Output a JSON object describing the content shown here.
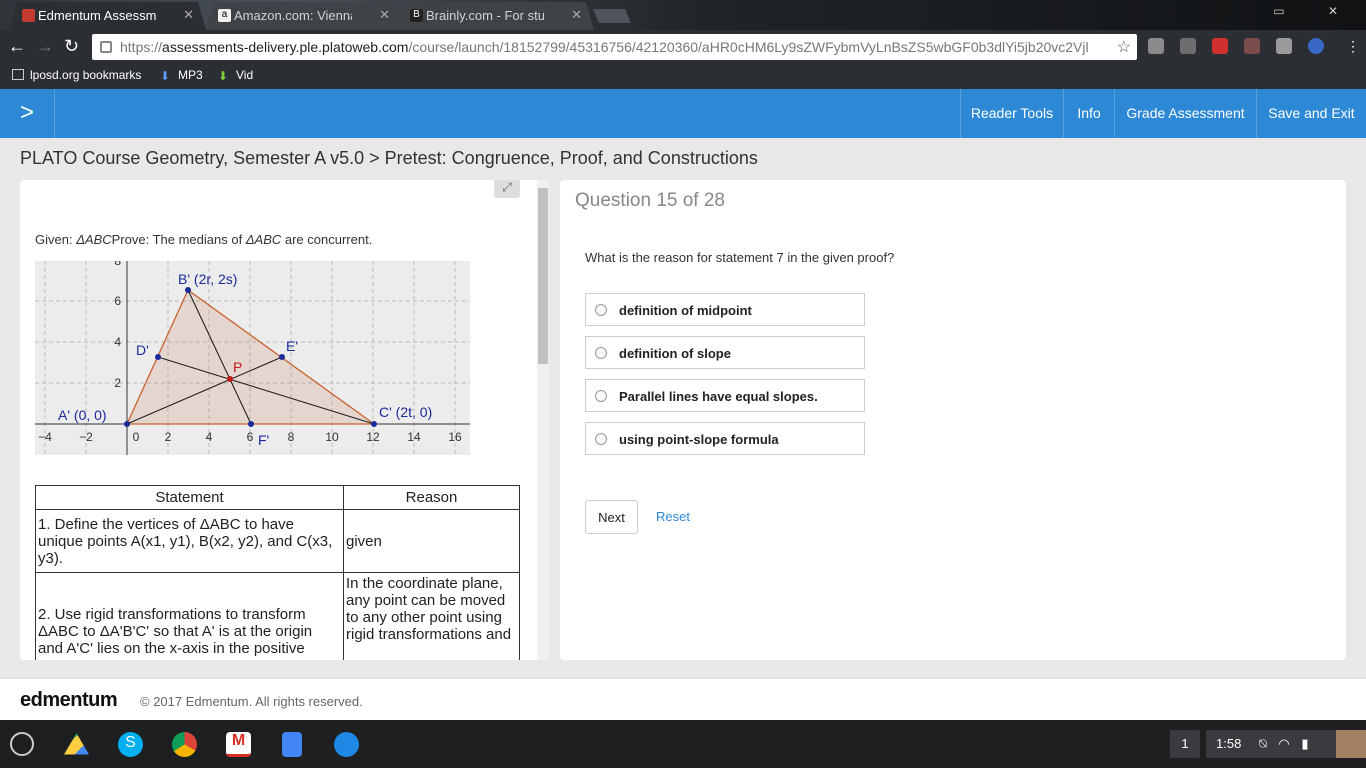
{
  "browser": {
    "tabs": [
      {
        "title": "Edmentum Assessment",
        "active": true,
        "favicon_color": "#c23b2e"
      },
      {
        "title": "Amazon.com: Vienna B",
        "active": false,
        "favicon_color": "#f0f0f0"
      },
      {
        "title": "Brainly.com - For studen",
        "active": false,
        "favicon_color": "#222222"
      }
    ],
    "url_scheme": "https://",
    "url_host": "assessments-delivery.ple.platoweb.com",
    "url_path": "/course/launch/18152799/45316756/42120360/aHR0cHM6Ly9sZWFybmVyLnBsZS5wbGF0b3dlYi5jb20vc2Vjl",
    "bookmarks": [
      {
        "label": "lposd.org bookmarks",
        "icon": "folder-icon"
      },
      {
        "label": "MP3",
        "icon": "download-icon"
      },
      {
        "label": "Vid",
        "icon": "download-green-icon"
      }
    ]
  },
  "appbar": {
    "buttons": [
      "Reader Tools",
      "Info",
      "Grade Assessment",
      "Save and Exit"
    ],
    "accent": "#2d89d6"
  },
  "breadcrumb": "PLATO Course Geometry, Semester A v5.0 > Pretest: Congruence, Proof, and Constructions",
  "left": {
    "given_prefix": "Given: ",
    "given_tri": "ΔABC",
    "prove_prefix": "Prove: The medians of ",
    "prove_tri": "ΔABC",
    "prove_suffix": " are concurrent.",
    "graph": {
      "x_ticks": [
        "−4",
        "−2",
        "0",
        "2",
        "4",
        "6",
        "8",
        "10",
        "12",
        "14",
        "16"
      ],
      "y_ticks": [
        "2",
        "4",
        "6",
        "8"
      ],
      "labels": {
        "A": "A' (0, 0)",
        "B": "B' (2r, 2s)",
        "C": "C' (2t, 0)",
        "D": "D'",
        "E": "E'",
        "F": "F'",
        "P": "P"
      }
    },
    "table": {
      "headers": [
        "Statement",
        "Reason"
      ],
      "rows": [
        {
          "statement": "1. Define the vertices of ΔABC to have unique points A(x1, y1), B(x2, y2), and C(x3, y3).",
          "reason": "given"
        },
        {
          "statement": "2. Use rigid transformations to transform ΔABC to ΔA'B'C' so that A' is at the origin and A'C' lies on the x-axis in the positive",
          "reason": "In the coordinate plane, any point can be moved to any other point using rigid transformations and"
        }
      ]
    }
  },
  "question": {
    "number": "Question 15 of 28",
    "text": "What is the reason for statement 7 in the given proof?",
    "choices": [
      "definition of midpoint",
      "definition of slope",
      "Parallel lines have equal slopes.",
      "using point-slope formula"
    ],
    "next_label": "Next",
    "reset_label": "Reset"
  },
  "footer": {
    "logo": "edmentum",
    "copyright": "© 2017 Edmentum. All rights reserved."
  },
  "shelf": {
    "notification_count": "1",
    "time": "1:58"
  }
}
